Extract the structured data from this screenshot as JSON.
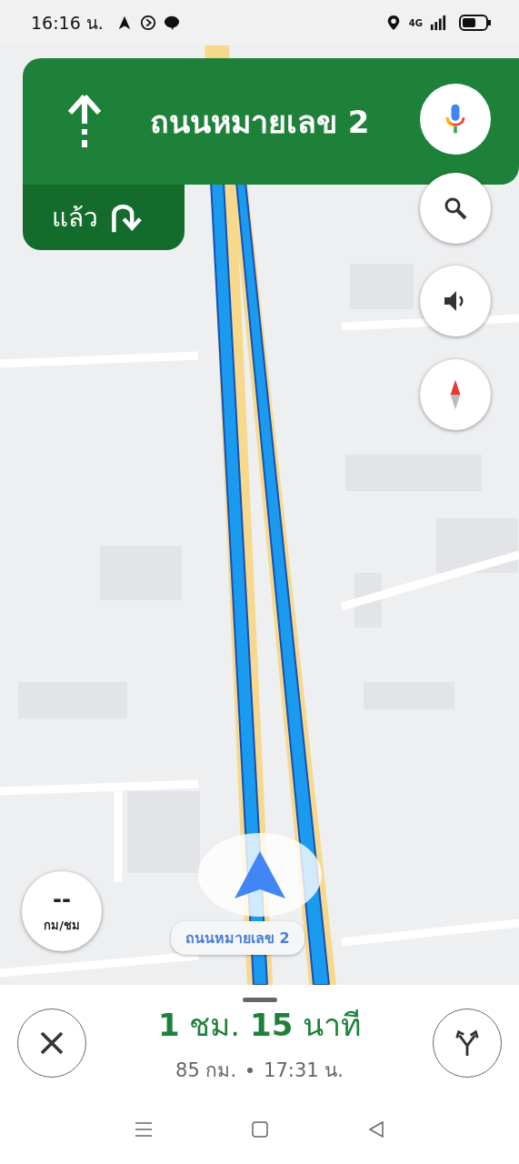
{
  "status_bar": {
    "time": "16:16 น.",
    "network": "4G"
  },
  "banner": {
    "road": "ถนนหมายเลข 2",
    "then_label": "แล้ว"
  },
  "speed": {
    "value": "--",
    "unit": "กม/ชม"
  },
  "route_label": "ถนนหมายเลข 2",
  "trip": {
    "duration": "**1** ชม. **15** นาที",
    "distance": "85 กม.",
    "eta": "17:31 น."
  }
}
